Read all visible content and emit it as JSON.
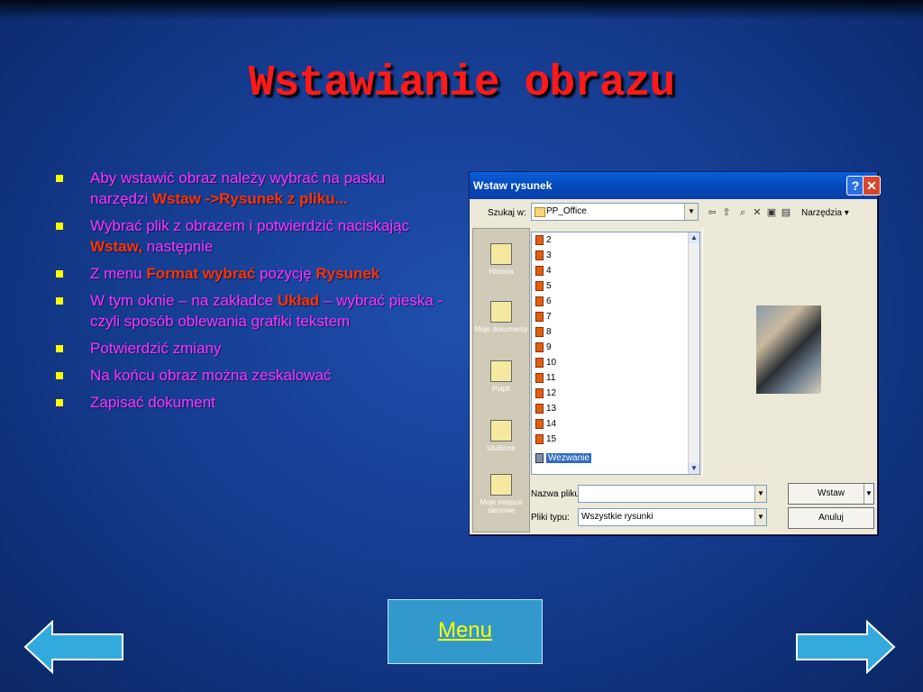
{
  "slide": {
    "title": "Wstawianie obrazu",
    "bullets": [
      {
        "parts": [
          "Aby wstawić obraz należy wybrać na pasku narzędzi ",
          "Wstaw ->Rysunek z pliku...",
          ""
        ]
      },
      {
        "parts": [
          "Wybrać plik z obrazem i potwierdzić naciskając ",
          "Wstaw,",
          " następnie"
        ]
      },
      {
        "parts": [
          "Z menu ",
          "Format wybrać",
          " pozycję ",
          "Rysunek"
        ]
      },
      {
        "parts": [
          "W tym oknie – na zakładce ",
          "Układ",
          " – wybrać pieska - czyli  sposób oblewania grafiki tekstem"
        ]
      },
      {
        "parts": [
          "Potwierdzić zmiany"
        ]
      },
      {
        "parts": [
          "Na końcu obraz można zeskalować"
        ]
      },
      {
        "parts": [
          "Zapisać dokument"
        ]
      }
    ],
    "bullet_color": "#ff33ff",
    "highlight_color": "#ff3300",
    "title_color": "#ff1a1a"
  },
  "dialog": {
    "title": "Wstaw rysunek",
    "look_in_label": "Szukaj w:",
    "look_in_value": "PP_Office",
    "tools_label": "Narzędzia",
    "places": [
      "Historia",
      "Moje dokumenty",
      "Pulpit",
      "Ulubione",
      "Moje miejsca sieciowe"
    ],
    "files": [
      "2",
      "3",
      "4",
      "5",
      "6",
      "7",
      "8",
      "9",
      "10",
      "11",
      "12",
      "13",
      "14",
      "15",
      "Wezwanie"
    ],
    "selected_file": "Wezwanie",
    "filename_label": "Nazwa pliku:",
    "filename_value": "",
    "filetype_label": "Pliki typu:",
    "filetype_value": "Wszystkie rysunki",
    "insert_button": "Wstaw",
    "cancel_button": "Anuluj"
  },
  "nav": {
    "menu_label": "Menu",
    "prev_icon": "left-arrow-icon",
    "next_icon": "right-arrow-icon"
  }
}
